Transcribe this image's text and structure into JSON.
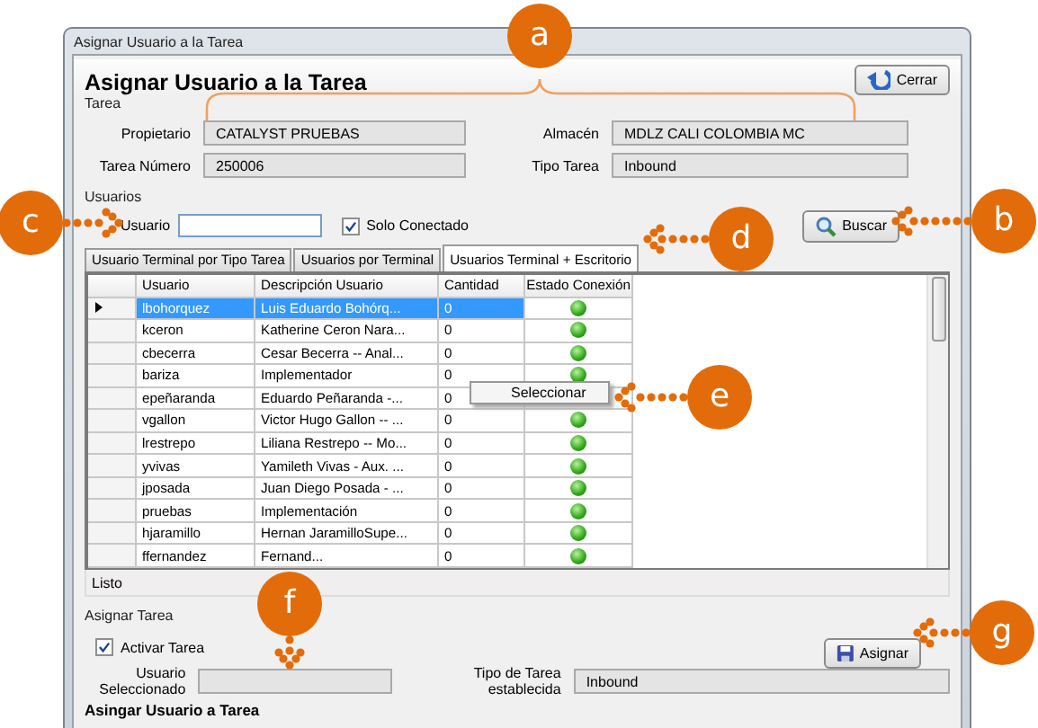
{
  "window": {
    "title": "Asignar Usuario a la Tarea"
  },
  "header": {
    "title": "Asignar Usuario a la Tarea",
    "close_button": "Cerrar"
  },
  "task_group": {
    "label": "Tarea",
    "fields": [
      {
        "label": "Propietario",
        "value": "CATALYST PRUEBAS"
      },
      {
        "label": "Almacén",
        "value": "MDLZ CALI COLOMBIA MC"
      },
      {
        "label": "Tarea Número",
        "value": "250006"
      },
      {
        "label": "Tipo Tarea",
        "value": "Inbound"
      }
    ]
  },
  "users_group": {
    "label": "Usuarios",
    "user_label": "Usuario",
    "only_connected": {
      "label": "Solo Conectado",
      "checked": true
    },
    "search_button": "Buscar"
  },
  "tabs": [
    {
      "label": "Usuario Terminal por Tipo Tarea",
      "selected": false
    },
    {
      "label": "Usuarios por Terminal",
      "selected": false
    },
    {
      "label": "Usuarios Terminal + Escritorio",
      "selected": true
    }
  ],
  "table": {
    "columns": [
      "Usuario",
      "Descripción Usuario",
      "Cantidad",
      "Estado Conexión"
    ],
    "rows": [
      {
        "user": "lbohorquez",
        "description": "Luis Eduardo Bohórq...",
        "quantity": "0",
        "connected": true,
        "selected": true
      },
      {
        "user": "kceron",
        "description": "Katherine Ceron Nara...",
        "quantity": "0",
        "connected": true,
        "selected": false
      },
      {
        "user": "cbecerra",
        "description": "Cesar Becerra  -- Anal...",
        "quantity": "0",
        "connected": true,
        "selected": false
      },
      {
        "user": "bariza",
        "description": "Implementador",
        "quantity": "0",
        "connected": true,
        "selected": false
      },
      {
        "user": "epeñaranda",
        "description": "Eduardo Peñaranda -...",
        "quantity": "0",
        "selected": false
      },
      {
        "user": "vgallon",
        "description": "Victor Hugo Gallon -- ...",
        "quantity": "0",
        "connected": true,
        "selected": false
      },
      {
        "user": "lrestrepo",
        "description": "Liliana Restrepo -- Mo...",
        "quantity": "0",
        "connected": true,
        "selected": false
      },
      {
        "user": "yvivas",
        "description": "Yamileth Vivas - Aux. ...",
        "quantity": "0",
        "connected": true,
        "selected": false
      },
      {
        "user": "jposada",
        "description": "Juan Diego Posada - ...",
        "quantity": "0",
        "connected": true,
        "selected": false
      },
      {
        "user": "pruebas",
        "description": "Implementación",
        "quantity": "0",
        "connected": true,
        "selected": false
      },
      {
        "user": "hjaramillo",
        "description": "Hernan JaramilloSupe...",
        "quantity": "0",
        "connected": true,
        "selected": false
      },
      {
        "user": "ffernandez",
        "description": "Fernand...",
        "quantity": "0",
        "connected": true,
        "selected": false
      }
    ]
  },
  "context_menu": {
    "items": [
      "Seleccionar"
    ]
  },
  "status_bar": "Listo",
  "assign_group": {
    "label": "Asignar Tarea",
    "activate": {
      "label": "Activar Tarea",
      "checked": true
    },
    "assign_button": "Asignar",
    "selected_user_label": "Usuario Seleccionado",
    "task_type_label": "Tipo de Tarea establecida",
    "task_type_value": "Inbound"
  },
  "footer": "Asingar Usuario a Tarea",
  "callouts": [
    {
      "letter": "a",
      "kind": "bracket"
    },
    {
      "letter": "b",
      "kind": "left"
    },
    {
      "letter": "c",
      "kind": "right"
    },
    {
      "letter": "d",
      "kind": "left"
    },
    {
      "letter": "e",
      "kind": "left"
    },
    {
      "letter": "f",
      "kind": "down"
    },
    {
      "letter": "g",
      "kind": "left"
    }
  ]
}
